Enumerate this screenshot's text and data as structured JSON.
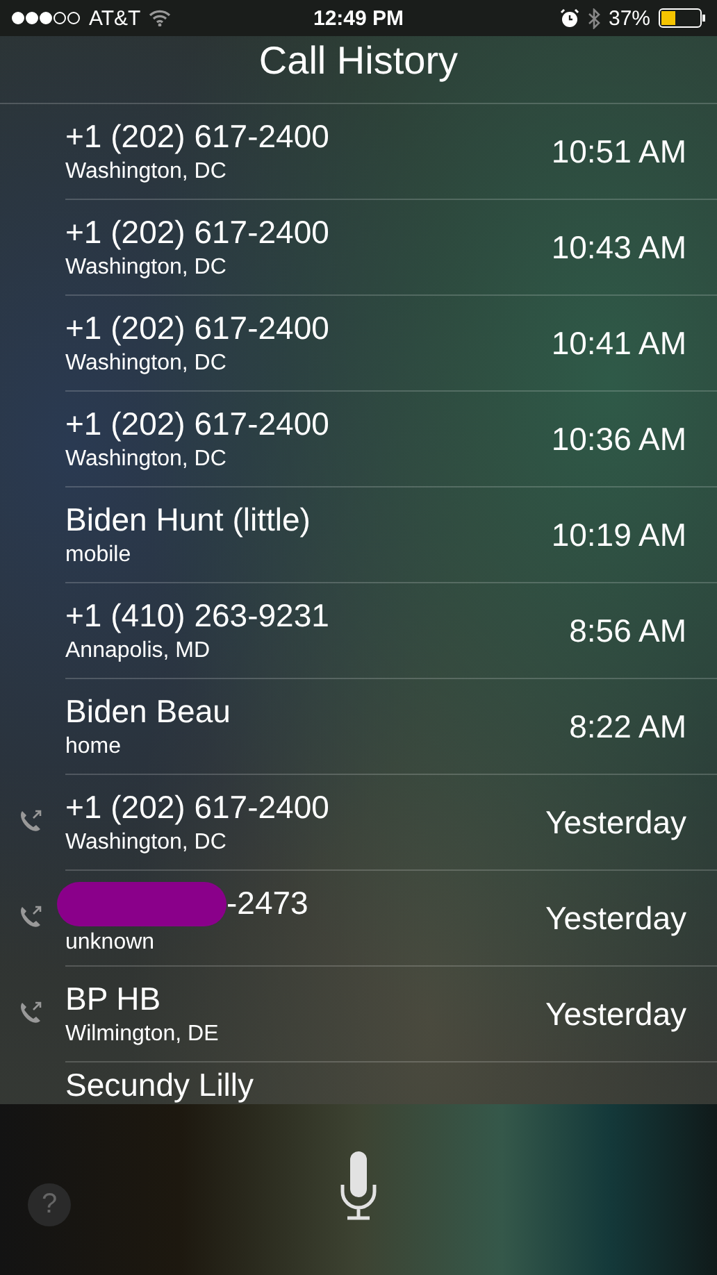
{
  "status_bar": {
    "carrier": "AT&T",
    "time": "12:49 PM",
    "battery": "37%"
  },
  "title": "Call History",
  "calls": [
    {
      "name": "+1 (202) 617-2400",
      "detail": "Washington, DC",
      "time": "10:51 AM",
      "outgoing": false,
      "redacted": false
    },
    {
      "name": "+1 (202) 617-2400",
      "detail": "Washington, DC",
      "time": "10:43 AM",
      "outgoing": false,
      "redacted": false
    },
    {
      "name": "+1 (202) 617-2400",
      "detail": "Washington, DC",
      "time": "10:41 AM",
      "outgoing": false,
      "redacted": false
    },
    {
      "name": "+1 (202) 617-2400",
      "detail": "Washington, DC",
      "time": "10:36 AM",
      "outgoing": false,
      "redacted": false
    },
    {
      "name": "Biden Hunt (little)",
      "detail": "mobile",
      "time": "10:19 AM",
      "outgoing": false,
      "redacted": false
    },
    {
      "name": "+1 (410) 263-9231",
      "detail": "Annapolis, MD",
      "time": "8:56 AM",
      "outgoing": false,
      "redacted": false
    },
    {
      "name": "Biden Beau",
      "detail": "home",
      "time": "8:22 AM",
      "outgoing": false,
      "redacted": false
    },
    {
      "name": "+1 (202) 617-2400",
      "detail": "Washington, DC",
      "time": "Yesterday",
      "outgoing": true,
      "redacted": false
    },
    {
      "name": "-2473",
      "detail": "unknown",
      "time": "Yesterday",
      "outgoing": true,
      "redacted": true
    },
    {
      "name": "BP HB",
      "detail": "Wilmington, DE",
      "time": "Yesterday",
      "outgoing": true,
      "redacted": false
    }
  ],
  "partial_call": {
    "name": "Secundy Lilly"
  },
  "help_label": "?"
}
